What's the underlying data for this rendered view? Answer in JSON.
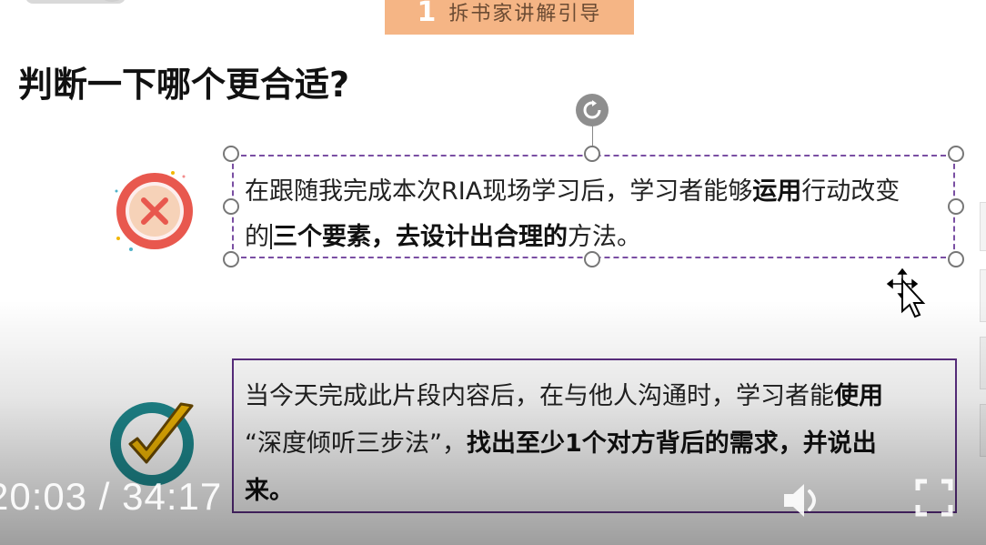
{
  "banner": {
    "number": "1",
    "text": "拆书家讲解引导"
  },
  "title": "判断一下哪个更合适?",
  "option_wrong": {
    "icon": "x-circle-icon",
    "line1_pre": "在跟随我完成本次RIA现场学习后，学习者能够",
    "line1_bold": "运用",
    "line1_post": "行动改变",
    "line2_pre": "的",
    "line2_bold1": "三个要素",
    "line2_mid": "，",
    "line2_bold2": "去设计出合理的",
    "line2_post": "方法。"
  },
  "option_right": {
    "icon": "checkmark-circle-icon",
    "line1_pre": "当今天完成此片段内容后，在与他人沟通时，学习者能",
    "line1_bold": "使用",
    "line2_pre": "“深度倾听三步法”，",
    "line2_bold": "找出至少1个对方背后的需求，并说出",
    "line3_bold": "来。"
  },
  "video": {
    "current_time": "20:03",
    "separator": " / ",
    "total_time": "34:17",
    "volume_icon": "volume-icon",
    "fullscreen_icon": "fullscreen-icon"
  },
  "colors": {
    "banner_bg": "#f5b585",
    "selection_border": "#7a4fa3",
    "box_border": "#5b2e82",
    "x_icon_red": "#e8584e",
    "check_teal": "#1f8a8f",
    "check_gold": "#f2b705"
  }
}
